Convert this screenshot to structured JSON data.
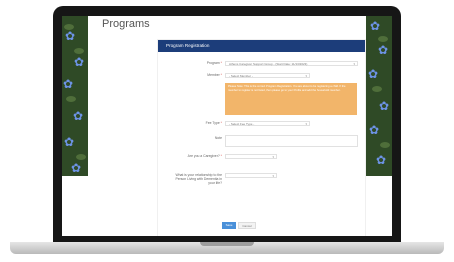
{
  "page": {
    "title": "Programs"
  },
  "form": {
    "header": "Program Registration",
    "program_label": "Program",
    "program_value": "Athens Caregiver Support Group - (Start Date: 11/13/2023)",
    "member_label": "Member",
    "member_value": "- Select Member -",
    "note": "Please Note: This is the correct Program Registration. You are about to be registering a child. If the member to register is not listed, then please go to your Profile and add the household member.",
    "fee_type_label": "Fee Type",
    "fee_type_value": "- Select Fee Type -",
    "note_label": "Note",
    "caregiver_label": "Are you a Caregiver?",
    "relationship_label": "What is your relationship to the Person Living with Dementia in your life?",
    "required_mark": "*",
    "save_label": "Save",
    "cancel_label": "Cancel"
  }
}
